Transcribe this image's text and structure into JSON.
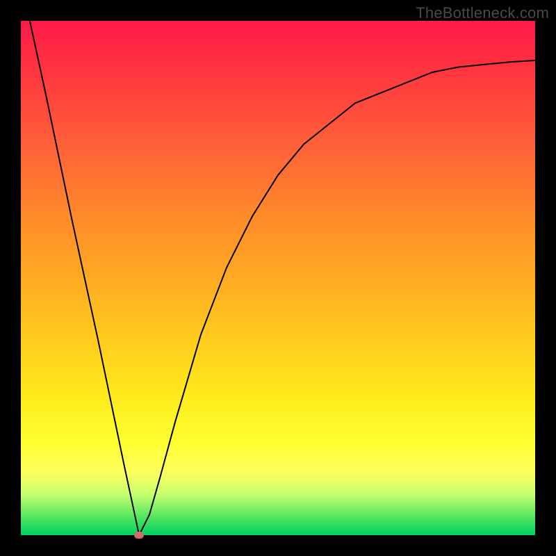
{
  "watermark": {
    "text": "TheBottleneck.com"
  },
  "chart_data": {
    "type": "line",
    "title": "",
    "xlabel": "",
    "ylabel": "",
    "xlim": [
      0,
      100
    ],
    "ylim": [
      0,
      100
    ],
    "grid": false,
    "legend": false,
    "series": [
      {
        "name": "curve",
        "x": [
          0,
          5,
          10,
          15,
          20,
          23,
          25,
          27,
          30,
          35,
          40,
          45,
          50,
          55,
          60,
          65,
          70,
          75,
          80,
          85,
          90,
          95,
          100
        ],
        "y": [
          108,
          85,
          61,
          38,
          14,
          0,
          4,
          11,
          22,
          39,
          52,
          62,
          70,
          76,
          80,
          84,
          86,
          88,
          90,
          91,
          91.5,
          92,
          92.3
        ]
      }
    ],
    "min_point": {
      "x": 23,
      "y": 0,
      "color": "#d46a6a"
    },
    "gradient_stops": [
      {
        "pct": 0,
        "color": "#ff1a4a"
      },
      {
        "pct": 8,
        "color": "#ff3040"
      },
      {
        "pct": 22,
        "color": "#ff5a3a"
      },
      {
        "pct": 38,
        "color": "#ff8a2a"
      },
      {
        "pct": 55,
        "color": "#ffb820"
      },
      {
        "pct": 72,
        "color": "#ffe81a"
      },
      {
        "pct": 82,
        "color": "#ffff30"
      },
      {
        "pct": 88,
        "color": "#fcff60"
      },
      {
        "pct": 92,
        "color": "#c8ff70"
      },
      {
        "pct": 96,
        "color": "#60e860"
      },
      {
        "pct": 100,
        "color": "#00d060"
      }
    ]
  }
}
